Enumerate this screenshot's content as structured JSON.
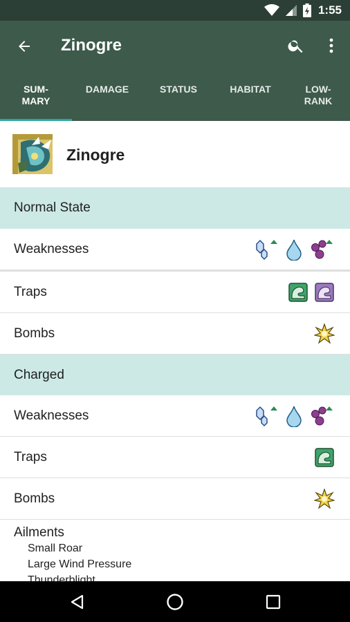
{
  "status_bar": {
    "time": "1:55",
    "icons": [
      "wifi-icon",
      "cell-signal-icon",
      "battery-charging-icon"
    ]
  },
  "app_bar": {
    "title": "Zinogre",
    "back_icon": "arrow-back-icon",
    "search_icon": "search-icon",
    "more_icon": "more-vertical-icon",
    "color": "#3d5a4b"
  },
  "tabs": [
    {
      "label": "SUM-\nMARY",
      "selected": true
    },
    {
      "label": "DAMAGE",
      "selected": false
    },
    {
      "label": "STATUS",
      "selected": false
    },
    {
      "label": "HABITAT",
      "selected": false
    },
    {
      "label": "LOW-\nRANK",
      "selected": false
    }
  ],
  "monster": {
    "name": "Zinogre",
    "icon": "zinogre-monster-icon"
  },
  "sections": [
    {
      "title": "Normal State",
      "rows": [
        {
          "label": "Weaknesses",
          "icons": [
            "ice-element-up-icon",
            "water-element-icon",
            "poison-up-icon"
          ]
        },
        {
          "label": "Traps",
          "icons": [
            "pitfall-trap-icon",
            "shock-trap-icon"
          ]
        },
        {
          "label": "Bombs",
          "icons": [
            "flash-bomb-icon"
          ]
        }
      ]
    },
    {
      "title": "Charged",
      "rows": [
        {
          "label": "Weaknesses",
          "icons": [
            "ice-element-up-icon",
            "water-element-icon",
            "poison-up-icon"
          ]
        },
        {
          "label": "Traps",
          "icons": [
            "pitfall-trap-icon"
          ]
        },
        {
          "label": "Bombs",
          "icons": [
            "flash-bomb-icon"
          ]
        }
      ]
    }
  ],
  "ailments": {
    "title": "Ailments",
    "items": [
      "Small Roar",
      "Large Wind Pressure",
      "Thunderblight"
    ]
  },
  "nav_bar": {
    "icons": [
      "back-triangle-icon",
      "home-circle-icon",
      "recents-square-icon"
    ]
  },
  "colors": {
    "primary": "#3d5a4b",
    "status": "#2c3f36",
    "section_bg": "#cce9e5",
    "accent": "#2aa6a0"
  }
}
